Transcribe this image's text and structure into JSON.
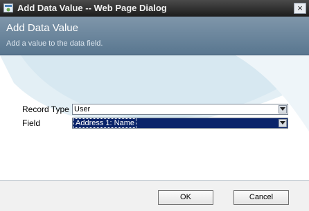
{
  "window": {
    "title": "Add Data Value -- Web Page Dialog",
    "close_glyph": "×"
  },
  "header": {
    "title": "Add Data Value",
    "subtitle": "Add a value to the data field."
  },
  "form": {
    "record_type": {
      "label": "Record Type",
      "value": "User"
    },
    "field": {
      "label": "Field",
      "value": "Address 1: Name"
    }
  },
  "footer": {
    "ok_label": "OK",
    "cancel_label": "Cancel"
  },
  "colors": {
    "header_bg": "#6a849b",
    "titlebar_bg": "#2c2c2c",
    "selected_bg": "#0a246a",
    "watermark": "#dcecf3"
  }
}
